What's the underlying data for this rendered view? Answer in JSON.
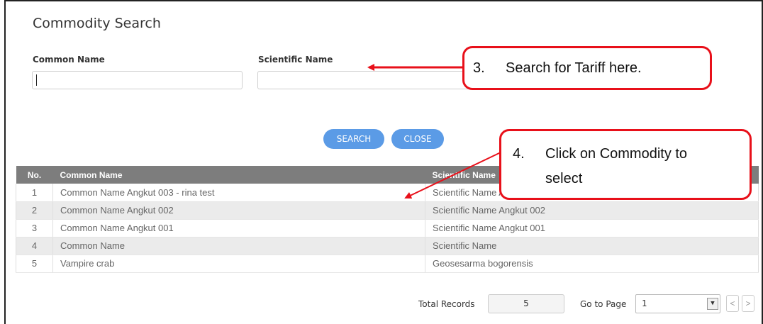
{
  "dialog": {
    "title": "Commodity Search"
  },
  "form": {
    "common_name_label": "Common Name",
    "common_name_value": "",
    "scientific_name_label": "Scientific Name",
    "scientific_name_value": ""
  },
  "buttons": {
    "search": "SEARCH",
    "close": "CLOSE"
  },
  "table": {
    "headers": {
      "no": "No.",
      "common_name": "Common Name",
      "scientific_name": "Scientific Name"
    },
    "rows": [
      {
        "no": "1",
        "common_name": "Common Name Angkut 003 - rina test",
        "scientific_name": "Scientific Name Angkut 003"
      },
      {
        "no": "2",
        "common_name": "Common Name Angkut 002",
        "scientific_name": "Scientific Name Angkut 002"
      },
      {
        "no": "3",
        "common_name": "Common Name Angkut 001",
        "scientific_name": "Scientific Name Angkut 001"
      },
      {
        "no": "4",
        "common_name": "Common Name",
        "scientific_name": "Scientific Name"
      },
      {
        "no": "5",
        "common_name": "Vampire crab",
        "scientific_name": "Geosesarma bogorensis"
      }
    ]
  },
  "pager": {
    "total_records_label": "Total Records",
    "total_records": "5",
    "go_to_page_label": "Go to Page",
    "page": "1",
    "prev": "<",
    "next": ">"
  },
  "annotations": {
    "callout_3": {
      "number": "3.",
      "text": "Search for Tariff here."
    },
    "callout_4": {
      "number": "4.",
      "line1": "Click on Commodity to",
      "line2": "select"
    }
  },
  "colors": {
    "accent_button": "#5b9be6",
    "header_bg": "#7d7d7d",
    "callout_border": "#e8101a"
  },
  "icons": {
    "dropdown": "chevron-down-icon",
    "prev": "chevron-left-icon",
    "next": "chevron-right-icon"
  }
}
